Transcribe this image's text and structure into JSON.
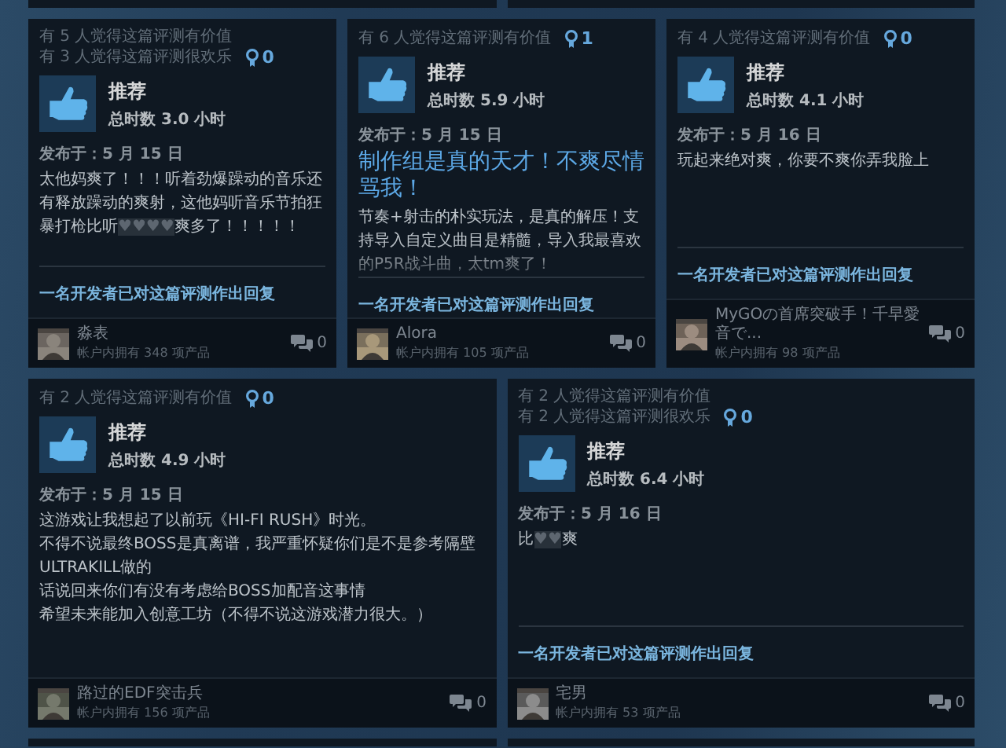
{
  "review_rows": [
    {
      "reviews": [
        {
          "helpful": "有 5 人觉得这篇评测有价值",
          "funny": "有 3 人觉得这篇评测很欢乐",
          "awards": "0",
          "recommendation": "推荐",
          "hours": "总时数 3.0 小时",
          "date": "发布于：5 月 15 日",
          "body": [
            {
              "spans": [
                {
                  "text": "太他妈爽了！！！听着劲爆躁动的音乐还有释放躁动的爽射，这他妈听音乐节拍狂暴打枪比听",
                  "censored": false
                },
                {
                  "text": "♥♥♥♥",
                  "censored": true
                },
                {
                  "text": "爽多了！！！！！",
                  "censored": false
                }
              ]
            }
          ],
          "faded": false,
          "dev_reply": "一名开发者已对这篇评测作出回复",
          "author": "淼表",
          "products": "帐户内拥有 348 项产品",
          "comments": "0"
        },
        {
          "helpful": "有 6 人觉得这篇评测有价值",
          "awards": "1",
          "recommendation": "推荐",
          "hours": "总时数 5.9 小时",
          "date": "发布于：5 月 15 日",
          "title": "制作组是真的天才！不爽尽情骂我！",
          "body": [
            {
              "spans": [
                {
                  "text": "节奏+射击的朴实玩法，是真的解压！支持导入自定义曲目是精髓，导入我最喜欢的P5R战斗曲，太tm爽了！",
                  "censored": false
                }
              ]
            }
          ],
          "faded": true,
          "dev_reply": "一名开发者已对这篇评测作出回复",
          "author": "Alora",
          "products": "帐户内拥有 105 项产品",
          "comments": "0"
        },
        {
          "helpful": "有 4 人觉得这篇评测有价值",
          "awards": "0",
          "recommendation": "推荐",
          "hours": "总时数 4.1 小时",
          "date": "发布于：5 月 16 日",
          "body": [
            {
              "spans": [
                {
                  "text": "玩起来绝对爽，你要不爽你弄我脸上",
                  "censored": false
                }
              ]
            }
          ],
          "faded": false,
          "dev_reply": "一名开发者已对这篇评测作出回复",
          "author": "MyGOの首席突破手！千早愛音で...",
          "products": "帐户内拥有 98 项产品",
          "comments": "0"
        }
      ]
    },
    {
      "reviews": [
        {
          "helpful": "有 2 人觉得这篇评测有价值",
          "awards": "0",
          "recommendation": "推荐",
          "hours": "总时数 4.9 小时",
          "date": "发布于：5 月 15 日",
          "body": [
            {
              "spans": [
                {
                  "text": "这游戏让我想起了以前玩《HI-FI RUSH》时光。",
                  "censored": false
                }
              ]
            },
            {
              "spans": [
                {
                  "text": "不得不说最终BOSS是真离谱，我严重怀疑你们是不是参考隔壁ULTRAKILL做的",
                  "censored": false
                }
              ]
            },
            {
              "spans": [
                {
                  "text": "话说回来你们有没有考虑给BOSS加配音这事情",
                  "censored": false
                }
              ]
            },
            {
              "spans": [
                {
                  "text": "希望未来能加入创意工坊（不得不说这游戏潜力很大。）",
                  "censored": false
                }
              ]
            }
          ],
          "faded": false,
          "author": "路过的EDF突击兵",
          "products": "帐户内拥有 156 项产品",
          "comments": "0"
        },
        {
          "helpful": "有 2 人觉得这篇评测有价值",
          "funny": "有 2 人觉得这篇评测很欢乐",
          "awards": "0",
          "recommendation": "推荐",
          "hours": "总时数 6.4 小时",
          "date": "发布于：5 月 16 日",
          "body": [
            {
              "spans": [
                {
                  "text": "比",
                  "censored": false
                },
                {
                  "text": "♥♥",
                  "censored": true
                },
                {
                  "text": "爽",
                  "censored": false
                }
              ]
            }
          ],
          "faded": false,
          "dev_reply": "一名开发者已对这篇评测作出回复",
          "author": "宅男",
          "products": "帐户内拥有 53 项产品",
          "comments": "0"
        }
      ]
    }
  ]
}
